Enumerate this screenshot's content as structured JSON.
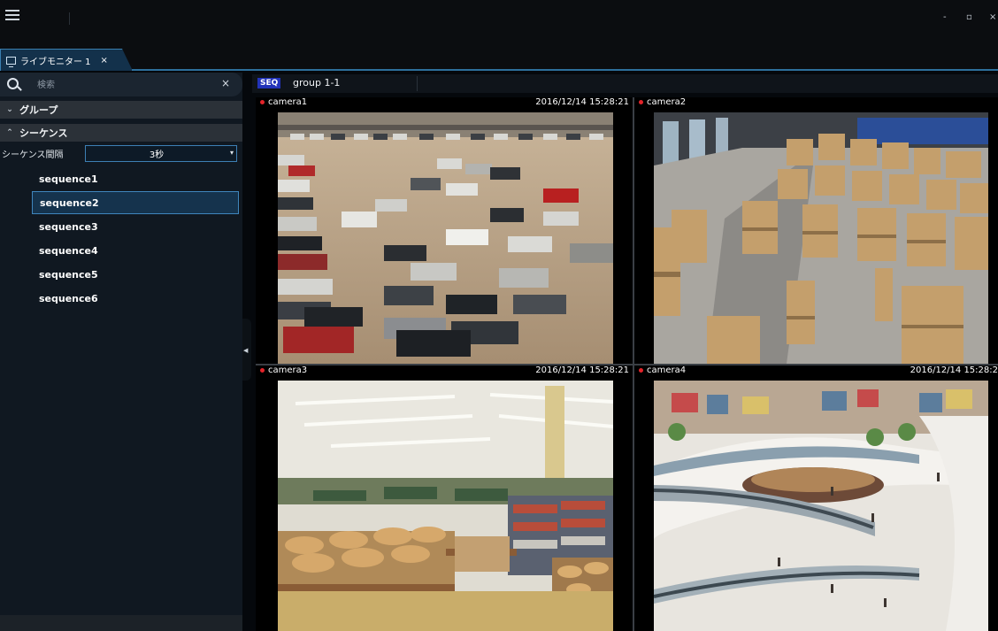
{
  "window": {
    "minimize_glyph": "-",
    "maximize_glyph": "▫",
    "close_glyph": "×"
  },
  "tab": {
    "label": "ライブモニター 1",
    "close": "×"
  },
  "search": {
    "placeholder": "検索",
    "clear": "×"
  },
  "sidebar": {
    "group_section": {
      "label": "グループ",
      "chevron": "⌄"
    },
    "sequence_section": {
      "label": "シーケンス",
      "chevron": "⌃"
    },
    "interval_label": "シーケンス間隔",
    "interval_value": "3秒",
    "sequences": [
      {
        "label": "sequence1",
        "selected": false
      },
      {
        "label": "sequence2",
        "selected": true
      },
      {
        "label": "sequence3",
        "selected": false
      },
      {
        "label": "sequence4",
        "selected": false
      },
      {
        "label": "sequence5",
        "selected": false
      },
      {
        "label": "sequence6",
        "selected": false
      }
    ]
  },
  "group_header": {
    "badge": "SEQ",
    "name": "group 1-1"
  },
  "cameras": [
    {
      "name": "camera1",
      "timestamp": "2016/12/14 15:28:21",
      "scene": "parking-lot"
    },
    {
      "name": "camera2",
      "timestamp": "",
      "scene": "warehouse"
    },
    {
      "name": "camera3",
      "timestamp": "2016/12/14 15:28:21",
      "scene": "supermarket"
    },
    {
      "name": "camera4",
      "timestamp": "2016/12/14 15:28:2",
      "scene": "shopping-mall"
    }
  ],
  "colors": {
    "accent": "#3d7fb4",
    "recording_dot": "#e4242a",
    "seq_badge": "#2233b9"
  }
}
